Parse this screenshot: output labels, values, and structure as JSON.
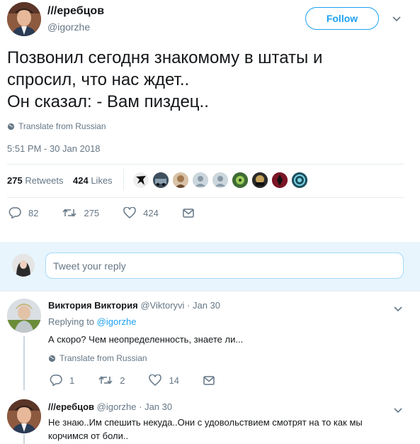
{
  "main_tweet": {
    "author_name": "///еребцов",
    "author_handle": "@igorzhe",
    "follow_label": "Follow",
    "text_lines": [
      "Позвонил сегодня знакомому в штаты и",
      "спросил, что нас ждет..",
      "Он сказал: - Вам пиздец.."
    ],
    "translate_label": "Translate from Russian",
    "timestamp": "5:51 PM - 30 Jan 2018",
    "retweets_count": "275",
    "retweets_label": "Retweets",
    "likes_count": "424",
    "likes_label": "Likes",
    "actions": {
      "replies": "82",
      "retweets": "275",
      "likes": "424"
    }
  },
  "reply_box": {
    "placeholder": "Tweet your reply"
  },
  "replies": [
    {
      "author_name": "Виктория Виктория",
      "author_handle": "@Viktoryvi",
      "date": "· Jan 30",
      "replying_prefix": "Replying to",
      "replying_to": "@igorzhe",
      "text": "А скоро? Чем неопределенность, знаете ли...",
      "translate_label": "Translate from Russian",
      "actions": {
        "replies": "1",
        "retweets": "2",
        "likes": "14"
      }
    },
    {
      "author_name": "///еребцов",
      "author_handle": "@igorzhe",
      "date": "· Jan 30",
      "text_lines": [
        "Не знаю..Им спешить некуда..Они с удовольствием смотрят на то как мы",
        "корчимся от боли.."
      ]
    }
  ],
  "icons": {
    "globe": "globe-icon",
    "reply": "reply-icon",
    "retweet": "retweet-icon",
    "like": "heart-icon",
    "message": "envelope-icon",
    "chevron": "chevron-down-icon"
  },
  "colors": {
    "accent": "#1da1f2",
    "muted": "#657786",
    "divider": "#e6ecf0"
  }
}
